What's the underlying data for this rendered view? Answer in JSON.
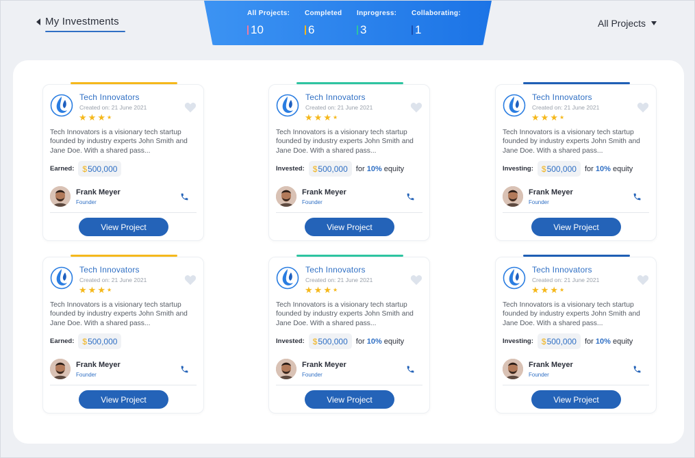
{
  "header": {
    "back_label": "My Investments",
    "filter_label": "All Projects"
  },
  "stats": [
    {
      "caption": "All Projects:",
      "value": "10",
      "color": "#f07aa0"
    },
    {
      "caption": "Completed",
      "value": "6",
      "color": "#f5b81b"
    },
    {
      "caption": "Inprogress:",
      "value": "3",
      "color": "#2ec4a0"
    },
    {
      "caption": "Collaborating:",
      "value": "1",
      "color": "#1a4fb0"
    }
  ],
  "cards": [
    {
      "accent": "#f5b81b",
      "title": "Tech Innovators",
      "date": "Created on: 21 June 2021",
      "desc": "Tech Innovators is a visionary tech startup founded by industry experts John Smith and Jane Doe. With a shared pass...",
      "fin_label": "Earned:",
      "amount": "500,000",
      "equity_pre": "",
      "equity_pct": "",
      "equity_post": "",
      "person": "Frank Meyer",
      "role": "Founder",
      "button": "View Project"
    },
    {
      "accent": "#2ec4a0",
      "title": "Tech Innovators",
      "date": "Created on: 21 June 2021",
      "desc": "Tech Innovators is a visionary tech startup founded by industry experts John Smith and Jane Doe. With a shared pass...",
      "fin_label": "Invested:",
      "amount": "500,000",
      "equity_pre": "for",
      "equity_pct": "10%",
      "equity_post": "equity",
      "person": "Frank Meyer",
      "role": "Founder",
      "button": "View Project"
    },
    {
      "accent": "#1f5fb5",
      "title": "Tech Innovators",
      "date": "Created on: 21 June 2021",
      "desc": "Tech Innovators is a visionary tech startup founded by industry experts John Smith and Jane Doe. With a shared pass...",
      "fin_label": "Investing:",
      "amount": "500,000",
      "equity_pre": "for",
      "equity_pct": "10%",
      "equity_post": "equity",
      "person": "Frank Meyer",
      "role": "Founder",
      "button": "View Project"
    },
    {
      "accent": "#f5b81b",
      "title": "Tech Innovators",
      "date": "Created on: 21 June 2021",
      "desc": "Tech Innovators is a visionary tech startup founded by industry experts John Smith and Jane Doe. With a shared pass...",
      "fin_label": "Earned:",
      "amount": "500,000",
      "equity_pre": "",
      "equity_pct": "",
      "equity_post": "",
      "person": "Frank Meyer",
      "role": "Founder",
      "button": "View Project"
    },
    {
      "accent": "#2ec4a0",
      "title": "Tech Innovators",
      "date": "Created on: 21 June 2021",
      "desc": "Tech Innovators is a visionary tech startup founded by industry experts John Smith and Jane Doe. With a shared pass...",
      "fin_label": "Invested:",
      "amount": "500,000",
      "equity_pre": "for",
      "equity_pct": "10%",
      "equity_post": "equity",
      "person": "Frank Meyer",
      "role": "Founder",
      "button": "View Project"
    },
    {
      "accent": "#1f5fb5",
      "title": "Tech Innovators",
      "date": "Created on: 21 June 2021",
      "desc": "Tech Innovators is a visionary tech startup founded by industry experts John Smith and Jane Doe. With a shared pass...",
      "fin_label": "Investing:",
      "amount": "500,000",
      "equity_pre": "for",
      "equity_pct": "10%",
      "equity_post": "equity",
      "person": "Frank Meyer",
      "role": "Founder",
      "button": "View Project"
    }
  ],
  "card_rating": 3.5,
  "icons": [
    "chevron-left-icon",
    "caret-down-icon",
    "brand-logo-icon",
    "heart-icon",
    "star-icon",
    "phone-icon",
    "avatar"
  ]
}
